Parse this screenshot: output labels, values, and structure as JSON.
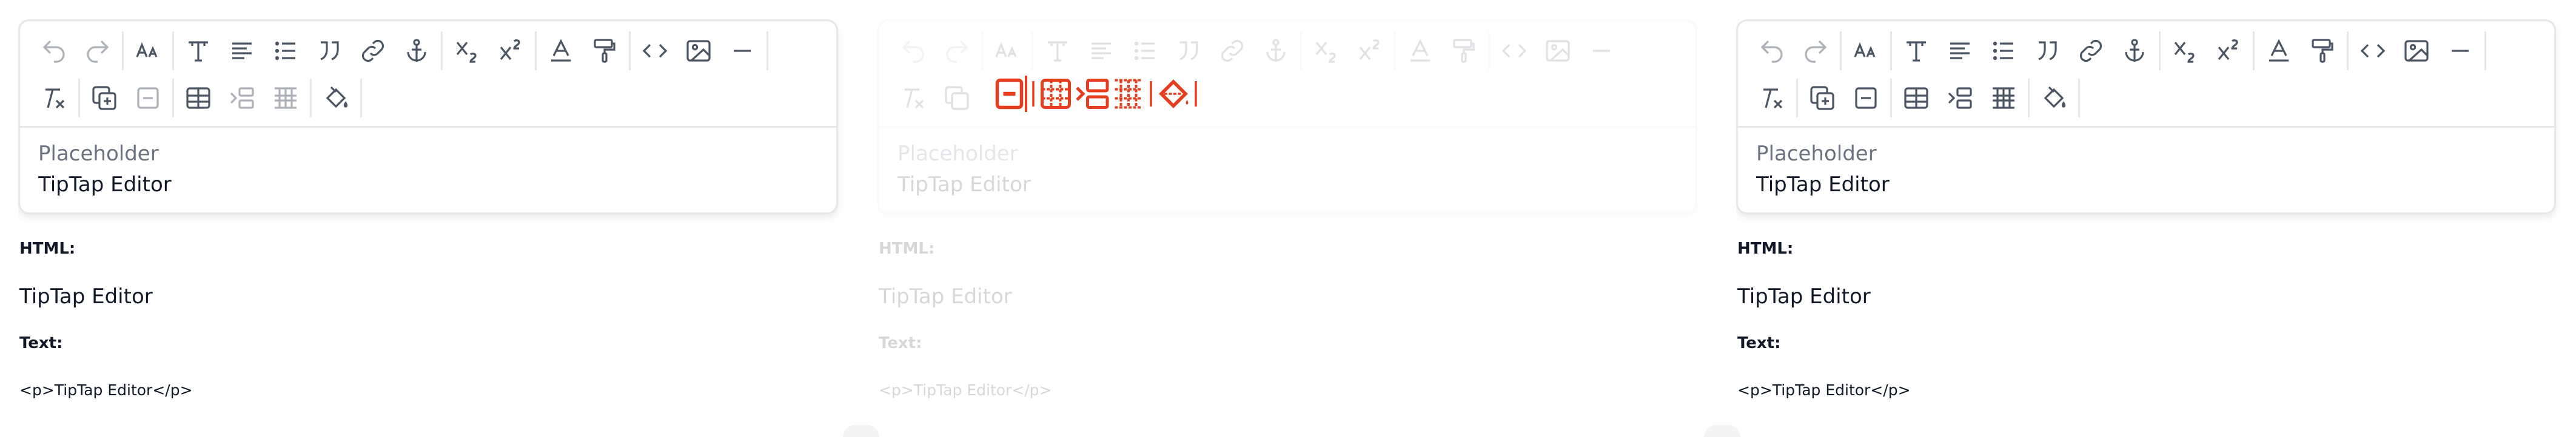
{
  "editors": [
    {
      "placeholder": "Placeholder",
      "content": "TipTap Editor",
      "html_label": "HTML:",
      "html_output": "TipTap Editor",
      "text_label": "Text:",
      "text_output": "<p>TipTap Editor</p>"
    },
    {
      "placeholder": "Placeholder",
      "content": "TipTap Editor",
      "html_label": "HTML:",
      "html_output": "TipTap Editor",
      "text_label": "Text:",
      "text_output": "<p>TipTap Editor</p>"
    },
    {
      "placeholder": "Placeholder",
      "content": "TipTap Editor",
      "html_label": "HTML:",
      "html_output": "TipTap Editor",
      "text_label": "Text:",
      "text_output": "<p>TipTap Editor</p>"
    }
  ],
  "toolbar_icons": {
    "row1": [
      "undo-icon",
      "redo-icon",
      "font-size-icon",
      "heading-icon",
      "align-icon",
      "bullet-list-icon",
      "blockquote-icon",
      "link-icon",
      "anchor-icon",
      "subscript-icon",
      "superscript-icon",
      "text-color-icon",
      "format-painter-icon",
      "code-icon",
      "image-icon",
      "horizontal-rule-icon"
    ],
    "row2": [
      "clear-format-icon",
      "add-block-icon",
      "remove-block-icon",
      "table-icon",
      "indent-icon",
      "grid-icon",
      "fill-color-icon"
    ]
  },
  "colors": {
    "accent_red": "#e63d1f",
    "border": "#e5e7eb",
    "icon": "#4b5563"
  }
}
